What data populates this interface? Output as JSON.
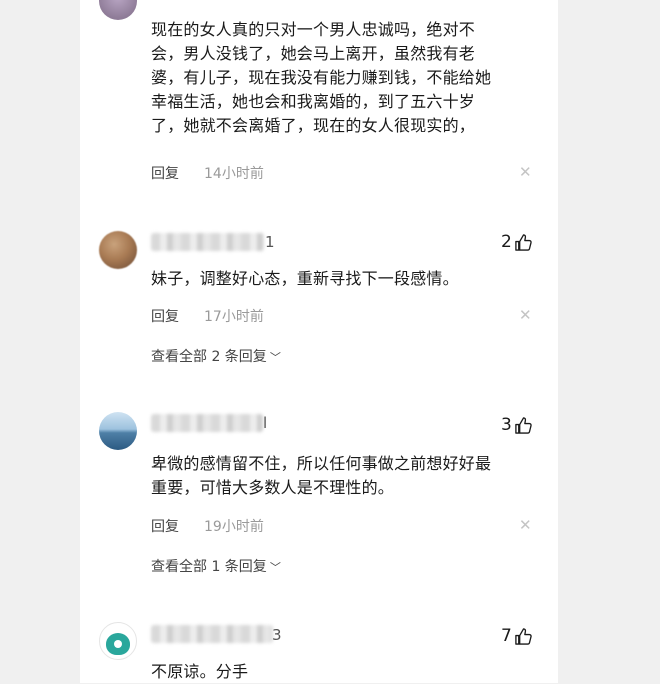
{
  "comments": [
    {
      "text": "现在的女人真的只对一个男人忠诚吗，绝对不\n会，男人没钱了，她会马上离开，虽然我有老\n婆，有儿子，现在我没有能力赚到钱，不能给她\n幸福生活，她也会和我离婚的，到了五六十岁\n了，她就不会离婚了，现在的女人很现实的，",
      "reply_label": "回复",
      "time": "14小时前"
    },
    {
      "name_tail": "1",
      "likes": "2",
      "text": "妹子，调整好心态，重新寻找下一段感情。",
      "reply_label": "回复",
      "time": "17小时前",
      "view_all": "查看全部 2 条回复"
    },
    {
      "name_tail": "l",
      "likes": "3",
      "text": "卑微的感情留不住，所以任何事做之前想好好最\n重要，可惜大多数人是不理性的。",
      "reply_label": "回复",
      "time": "19小时前",
      "view_all": "查看全部 1 条回复"
    },
    {
      "name_tail": "3",
      "likes": "7",
      "text": "不原谅。分手"
    }
  ],
  "icons": {
    "like": "thumbs-up-icon",
    "close": "close-icon",
    "expand": "chevron-down-icon"
  }
}
